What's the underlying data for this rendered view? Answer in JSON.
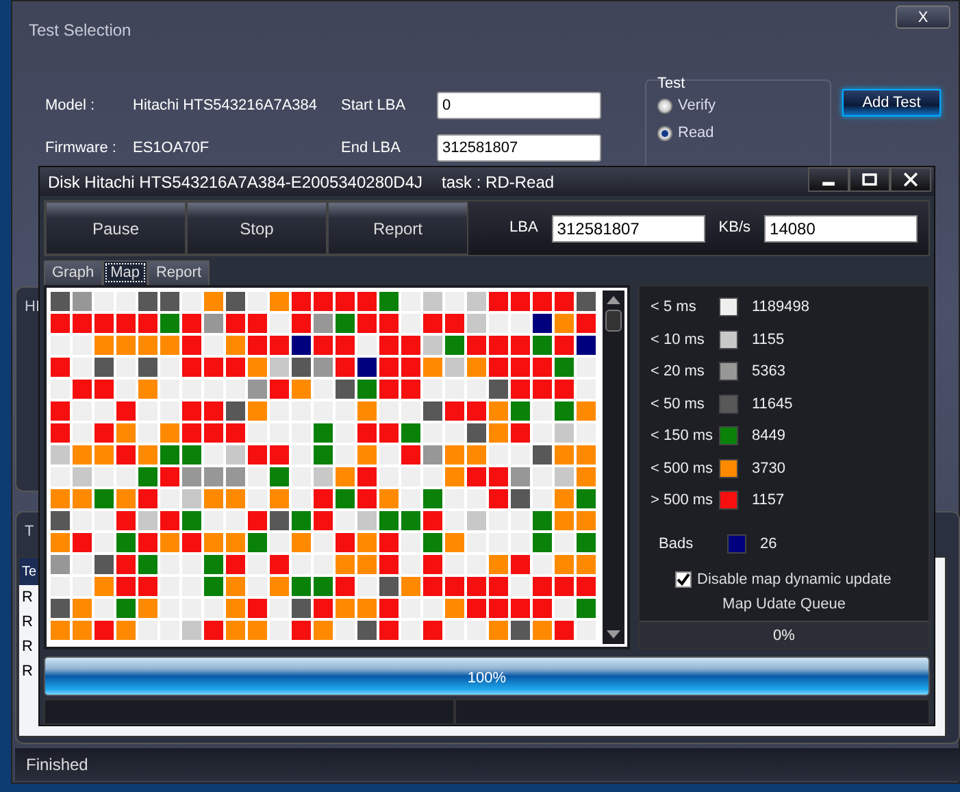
{
  "background_window": {
    "title": "Test Selection",
    "close": "X",
    "fields": [
      {
        "label": "Model :",
        "value": "Hitachi HTS543216A7A384"
      },
      {
        "label": "Firmware :",
        "value": "ES1OA70F"
      }
    ],
    "lba": [
      {
        "label": "Start LBA",
        "value": "0"
      },
      {
        "label": "End LBA",
        "value": "312581807"
      }
    ],
    "test_group": {
      "title": "Test",
      "options": [
        {
          "label": "Verify",
          "selected": false
        },
        {
          "label": "Read",
          "selected": true
        }
      ]
    },
    "add_button": "Add Test",
    "panel_1": {
      "title": "HI"
    },
    "panel_2": {
      "title": "T",
      "header": "Te",
      "rows": [
        "R",
        "R",
        "R",
        "R"
      ]
    },
    "status": "Finished"
  },
  "disk_window": {
    "title": "Disk Hitachi HTS543216A7A384-E2005340280D4J",
    "task": "task : RD-Read",
    "toolbar": [
      "Pause",
      "Stop",
      "Report"
    ],
    "lba": {
      "label": "LBA",
      "value": "312581807"
    },
    "speed": {
      "label": "KB/s",
      "value": "14080"
    },
    "tabs": [
      {
        "label": "Graph",
        "selected": false
      },
      {
        "label": "Map",
        "selected": true
      },
      {
        "label": "Report",
        "selected": false
      }
    ],
    "legend": [
      {
        "label": "< 5 ms",
        "color": "#efefef",
        "count": "1189498",
        "kind": "range"
      },
      {
        "label": "< 10 ms",
        "color": "#c8c8c8",
        "count": "1155",
        "kind": "range"
      },
      {
        "label": "< 20 ms",
        "color": "#979797",
        "count": "5363",
        "kind": "range"
      },
      {
        "label": "< 50 ms",
        "color": "#585858",
        "count": "11645",
        "kind": "range"
      },
      {
        "label": "< 150 ms",
        "color": "#0a820a",
        "count": "8449",
        "kind": "range"
      },
      {
        "label": "< 500 ms",
        "color": "#ff8a00",
        "count": "3730",
        "kind": "range"
      },
      {
        "label": "> 500 ms",
        "color": "#f50f0f",
        "count": "1157",
        "kind": "range"
      },
      {
        "label": "Bads",
        "color": "#00007f",
        "count": "26",
        "kind": "bad"
      }
    ],
    "checkbox": {
      "label": "Disable map dynamic update",
      "checked": true
    },
    "queue": {
      "label": "Map Udate Queue",
      "reading": "0%",
      "level": 0
    },
    "progress": {
      "reading": "100%",
      "level": 1
    }
  }
}
